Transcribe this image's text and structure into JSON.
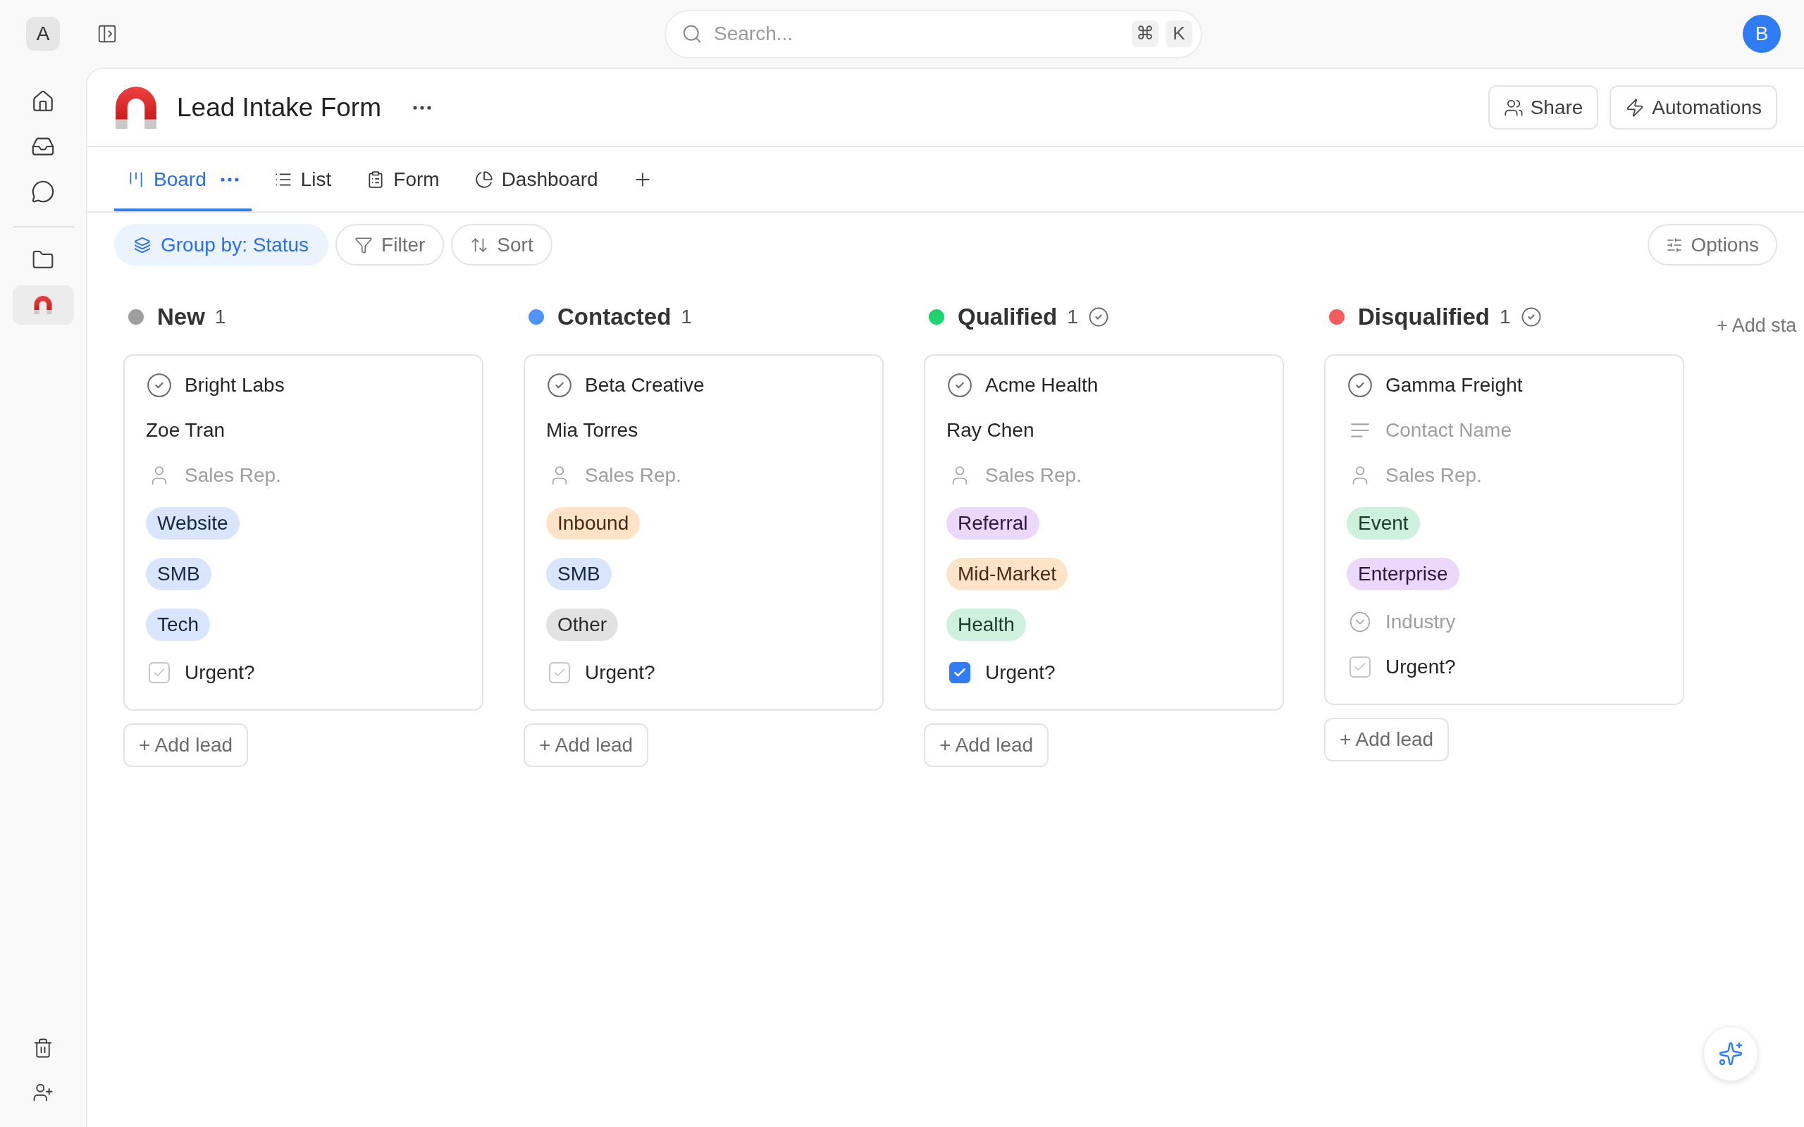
{
  "sidebar": {
    "workspace": "A",
    "nav_items": [
      {
        "selected": false
      },
      {
        "selected": false
      },
      {
        "selected": false
      }
    ],
    "pinned_items": [
      {
        "selected": false
      },
      {
        "selected": true
      }
    ]
  },
  "topbar": {
    "search": {
      "placeholder": "Search...",
      "shortcut_keys": [
        "⌘",
        "K"
      ]
    },
    "user_avatar": "B"
  },
  "page": {
    "title": "Lead Intake Form",
    "actions": [
      "Share",
      "Automations"
    ]
  },
  "tabs": [
    {
      "label": "Board",
      "selected": true
    },
    {
      "label": "List",
      "selected": false
    },
    {
      "label": "Form",
      "selected": false
    },
    {
      "label": "Dashboard",
      "selected": false
    }
  ],
  "toolbar": {
    "group_by": {
      "label": "Group by: Status",
      "active": true
    },
    "controls": [
      "Filter",
      "Sort"
    ],
    "options": "Options"
  },
  "board": {
    "columns": [
      {
        "name": "New",
        "count": "1",
        "color": "#9e9e9e",
        "completed": false,
        "add_label": "+ Add lead",
        "cards": [
          {
            "fields": [
              {
                "kind": "title",
                "value": "Bright Labs"
              },
              {
                "kind": "text",
                "value": "Zoe Tran"
              },
              {
                "kind": "person",
                "placeholder": "Sales Rep."
              },
              {
                "kind": "tag",
                "value": "Website",
                "color": "#d8e5fd"
              },
              {
                "kind": "tag",
                "value": "SMB",
                "color": "#d8e5fd"
              },
              {
                "kind": "tag",
                "value": "Tech",
                "color": "#d8e5fd"
              },
              {
                "kind": "checkbox",
                "label": "Urgent?",
                "checked": false
              }
            ]
          }
        ]
      },
      {
        "name": "Contacted",
        "count": "1",
        "color": "#4f95f9",
        "completed": false,
        "add_label": "+ Add lead",
        "cards": [
          {
            "fields": [
              {
                "kind": "title",
                "value": "Beta Creative"
              },
              {
                "kind": "text",
                "value": "Mia Torres"
              },
              {
                "kind": "person",
                "placeholder": "Sales Rep."
              },
              {
                "kind": "tag",
                "value": "Inbound",
                "color": "#fee3c6"
              },
              {
                "kind": "tag",
                "value": "SMB",
                "color": "#d8e5fd"
              },
              {
                "kind": "tag",
                "value": "Other",
                "color": "#e2e2e2"
              },
              {
                "kind": "checkbox",
                "label": "Urgent?",
                "checked": false
              }
            ]
          }
        ]
      },
      {
        "name": "Qualified",
        "count": "1",
        "color": "#1fd36d",
        "completed": true,
        "add_label": "+ Add lead",
        "cards": [
          {
            "fields": [
              {
                "kind": "title",
                "value": "Acme Health"
              },
              {
                "kind": "text",
                "value": "Ray Chen"
              },
              {
                "kind": "person",
                "placeholder": "Sales Rep."
              },
              {
                "kind": "tag",
                "value": "Referral",
                "color": "#ecd8fb"
              },
              {
                "kind": "tag",
                "value": "Mid-Market",
                "color": "#fee3c6"
              },
              {
                "kind": "tag",
                "value": "Health",
                "color": "#cdf1dc"
              },
              {
                "kind": "checkbox",
                "label": "Urgent?",
                "checked": true
              }
            ]
          }
        ]
      },
      {
        "name": "Disqualified",
        "count": "1",
        "color": "#f25c5c",
        "completed": true,
        "add_label": "+ Add lead",
        "cards": [
          {
            "fields": [
              {
                "kind": "title",
                "value": "Gamma Freight"
              },
              {
                "kind": "text",
                "placeholder": "Contact Name"
              },
              {
                "kind": "person",
                "placeholder": "Sales Rep."
              },
              {
                "kind": "tag",
                "value": "Event",
                "color": "#cdf1dc"
              },
              {
                "kind": "tag",
                "value": "Enterprise",
                "color": "#ecd8fb"
              },
              {
                "kind": "select",
                "placeholder": "Industry"
              },
              {
                "kind": "checkbox",
                "label": "Urgent?",
                "checked": false
              }
            ]
          }
        ]
      }
    ],
    "add_status": "+ Add sta"
  }
}
